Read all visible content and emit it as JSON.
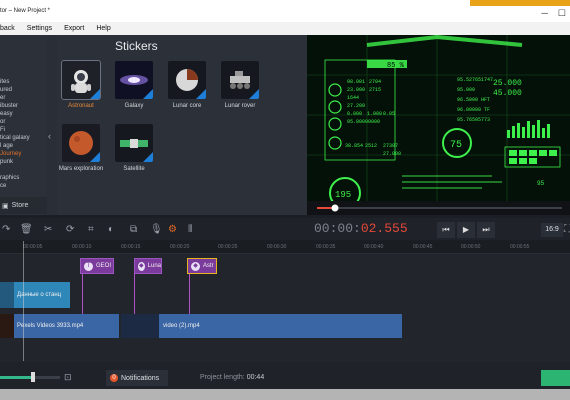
{
  "window": {
    "title": "tor – New Project *"
  },
  "menu": [
    "back",
    "Settings",
    "Export",
    "Help"
  ],
  "categories": [
    "ites",
    "ured",
    "er",
    "ibuster",
    "easy",
    "or",
    "Fi",
    "tical galaxy",
    "l age",
    "Journey",
    "punk",
    "raphics",
    "ce"
  ],
  "store_label": "Store",
  "stickers": {
    "title": "Stickers",
    "items": [
      {
        "label": "Astronaut",
        "selected": true
      },
      {
        "label": "Galaxy"
      },
      {
        "label": "Lunar core"
      },
      {
        "label": "Lunar rover"
      },
      {
        "label": "Mars exploration"
      },
      {
        "label": "Satellite"
      }
    ]
  },
  "preview": {
    "values": [
      "85 %",
      "98.001",
      "2704",
      "25.000",
      "45.000",
      "95.527651747",
      "23.000",
      "2715",
      "1644",
      "27.200",
      "95.000",
      "96.5000 HFT",
      "0.000",
      "1.000",
      "0.05",
      "95.80000000",
      "96.00000 TF",
      "95.76505773",
      "75",
      "195",
      "38.854",
      "2512",
      "27307",
      "27.000",
      "95"
    ],
    "accent": "#3ef04b"
  },
  "player": {
    "time_main": "00:00:",
    "time_ms": "02.555",
    "aspect": "16:9"
  },
  "ruler": [
    "00:00:05",
    "00:00:10",
    "00:00:15",
    "00:00:20",
    "00:00:25",
    "00:00:30",
    "00:00:35",
    "00:00:40",
    "00:00:45",
    "00:00:50",
    "00:00:55"
  ],
  "timeline": {
    "sticker_clips": [
      "GEOI",
      "Luna",
      "Astr"
    ],
    "title_clip": "Данные о станц",
    "video_clips": [
      "Pexels Videos 3933.mp4",
      "video (2).mp4"
    ]
  },
  "notifications": {
    "label": "Notifications",
    "count": "0"
  },
  "project_length": {
    "label": "Project length:",
    "value": "00:44"
  },
  "colors": {
    "accent": "#e0732a",
    "sticker_clip": "#7b3b9c",
    "video_clip": "#3a66a5",
    "export": "#2bb472"
  }
}
